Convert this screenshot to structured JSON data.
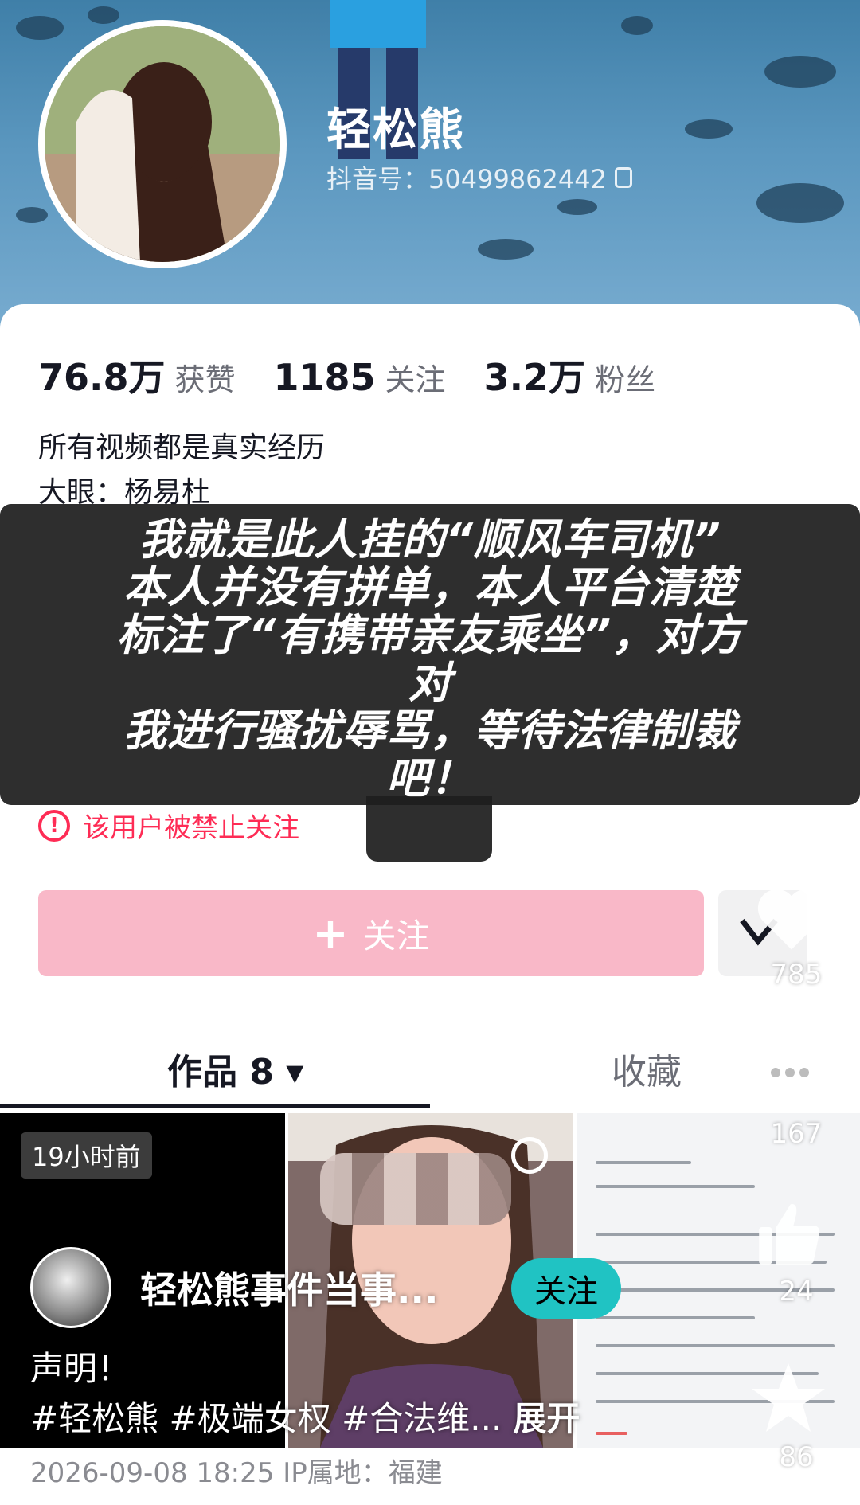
{
  "profile": {
    "name": "轻松熊",
    "douyin_id": "抖音号：50499862442"
  },
  "stats": [
    {
      "value": "76.8万",
      "label": "获赞"
    },
    {
      "value": "1185",
      "label": "关注"
    },
    {
      "value": "3.2万",
      "label": "粉丝"
    }
  ],
  "bio": {
    "line1": "所有视频都是真实经历",
    "line2": "大眼：杨易杜"
  },
  "overlay_caption": "我就是此人挂的“顺风车司机”\n本人并没有拼单，本人平台清楚\n标注了“有携带亲友乘坐”，对方\n对\n我进行骚扰辱骂，等待法律制裁\n吧！",
  "banned_notice": "该用户被禁止关注",
  "follow_button": {
    "icon": "+",
    "label": "关注"
  },
  "tabs": {
    "works": "作品 8",
    "works_caret": "▾",
    "favorites": "收藏"
  },
  "grid": {
    "time_badge": "19小时前"
  },
  "actions": {
    "likes": "785",
    "comments": "167",
    "thumbs": "24",
    "favorites": "86"
  },
  "video": {
    "author": "轻松熊事件当事...",
    "follow_label": "关注",
    "description": "声明！",
    "hashtags": "#轻松熊 #极端女权 #合法维...",
    "expand": "展开",
    "meta": "2026-09-08 18:25  IP属地：福建"
  },
  "colors": {
    "accent_red": "#fe2c55",
    "follow_disabled": "#f9b8c8",
    "follow_pill": "#20c3c3"
  }
}
